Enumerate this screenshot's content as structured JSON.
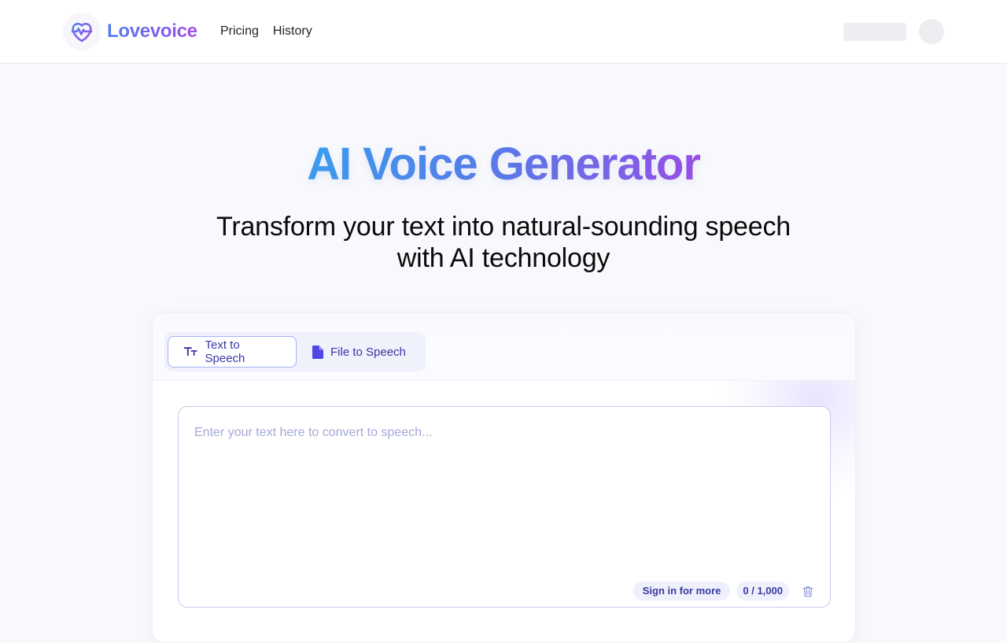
{
  "header": {
    "brand": "Lovevoice",
    "nav": [
      {
        "label": "Pricing"
      },
      {
        "label": "History"
      }
    ]
  },
  "hero": {
    "title": "AI Voice Generator",
    "subtitle_line1": "Transform your text into natural-sounding speech",
    "subtitle_line2": "with AI technology"
  },
  "tabs": [
    {
      "label": "Text to Speech",
      "icon": "text-icon",
      "active": true
    },
    {
      "label": "File to Speech",
      "icon": "file-icon",
      "active": false
    }
  ],
  "editor": {
    "placeholder": "Enter your text here to convert to speech...",
    "value": "",
    "sign_in_label": "Sign in for more",
    "char_count": "0 / 1,000"
  },
  "colors": {
    "accent": "#4f46e5",
    "brand_gradient_start": "#3aa0ee",
    "brand_gradient_end": "#9a4fe6"
  }
}
